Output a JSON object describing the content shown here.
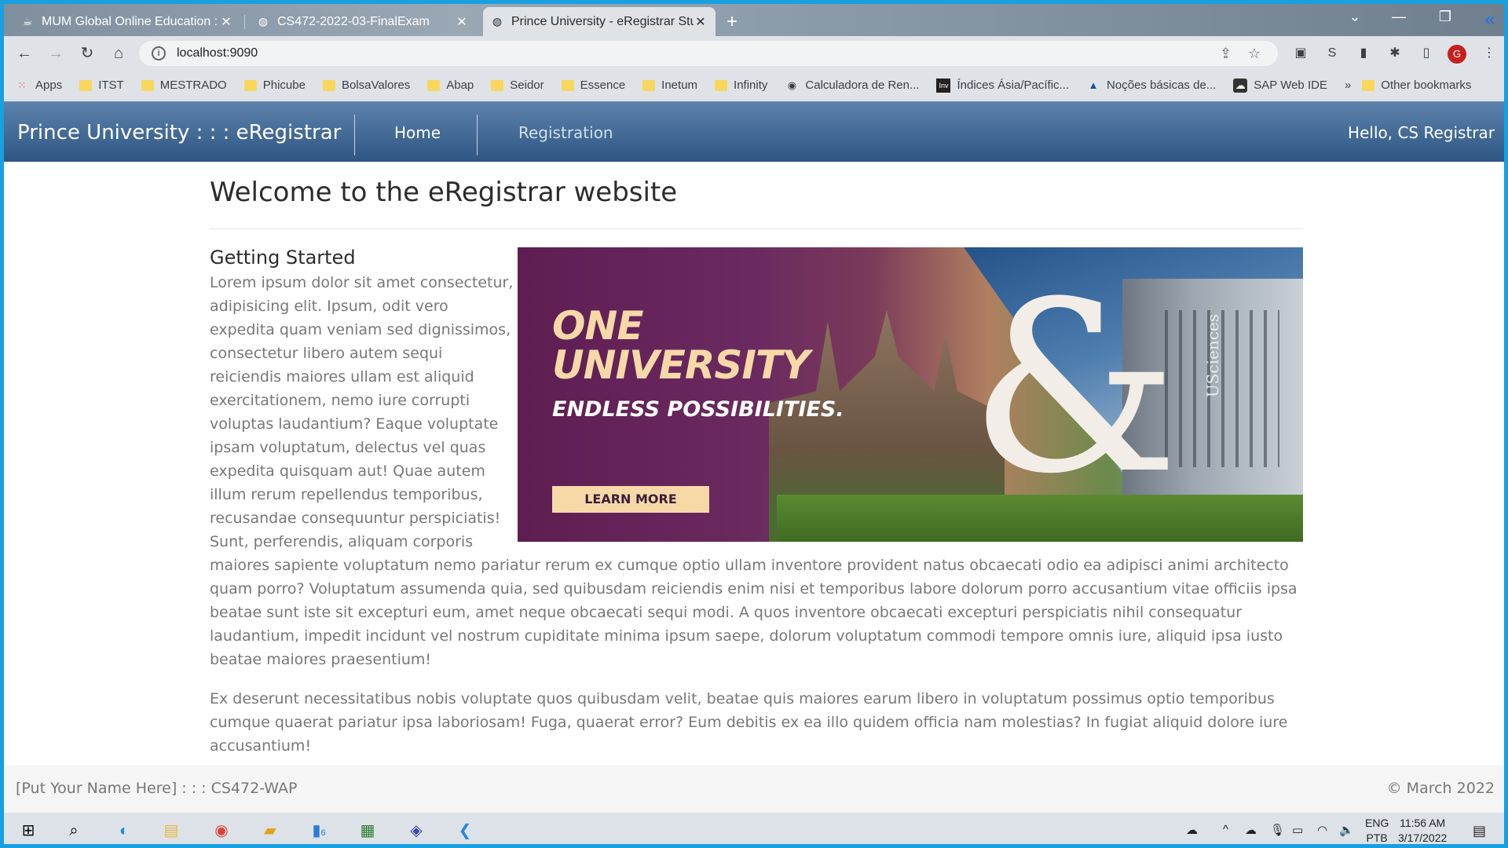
{
  "browser": {
    "tabs": [
      {
        "title": "MUM Global Online Education :",
        "icon": "cup-icon",
        "active": false
      },
      {
        "title": "CS472-2022-03-FinalExam",
        "icon": "globe-icon",
        "active": false
      },
      {
        "title": "Prince University - eRegistrar Stu",
        "icon": "globe-icon",
        "active": true
      }
    ],
    "url": "localhost:9090",
    "profile_initial": "G",
    "bookmarks": [
      {
        "label": "Apps",
        "icon": "apps-grid-icon"
      },
      {
        "label": "ITST",
        "icon": "folder-icon"
      },
      {
        "label": "MESTRADO",
        "icon": "folder-icon"
      },
      {
        "label": "Phicube",
        "icon": "folder-icon"
      },
      {
        "label": "BolsaValores",
        "icon": "folder-icon"
      },
      {
        "label": "Abap",
        "icon": "folder-icon"
      },
      {
        "label": "Seidor",
        "icon": "folder-icon"
      },
      {
        "label": "Essence",
        "icon": "folder-icon"
      },
      {
        "label": "Inetum",
        "icon": "folder-icon"
      },
      {
        "label": "Infinity",
        "icon": "folder-icon"
      },
      {
        "label": "Calculadora de Ren...",
        "icon": "calculator-icon"
      },
      {
        "label": "Índices Ásia/Pacífic...",
        "icon": "investing-icon"
      },
      {
        "label": "Noções básicas de...",
        "icon": "dev-icon"
      },
      {
        "label": "SAP Web IDE",
        "icon": "cloud-icon"
      }
    ],
    "more_bookmarks": "»",
    "other_bookmarks": "Other bookmarks"
  },
  "navbar": {
    "brand": "Prince University : : : eRegistrar",
    "links": [
      "Home",
      "Registration"
    ],
    "greeting": "Hello, CS Registrar"
  },
  "main": {
    "title": "Welcome to the eRegistrar website",
    "subtitle": "Getting Started",
    "banner": {
      "line1": "ONE",
      "line2": "UNIVERSITY",
      "line3": "ENDLESS POSSIBILITIES.",
      "button": "LEARN MORE",
      "brand": "USciences"
    },
    "para1": "Lorem ipsum dolor sit amet consectetur, adipisicing elit. Ipsum, odit vero expedita quam veniam sed dignissimos, consectetur libero autem sequi reiciendis maiores ullam est aliquid exercitationem, nemo iure corrupti voluptas laudantium? Eaque voluptate ipsam voluptatum, delectus vel quas expedita quisquam aut! Quae autem illum rerum repellendus temporibus, recusandae consequuntur perspiciatis! Sunt, perferendis, aliquam corporis maiores sapiente voluptatum nemo pariatur rerum ex cumque optio ullam inventore provident natus obcaecati odio ea adipisci animi architecto quam porro? Voluptatum assumenda quia, sed quibusdam reiciendis enim nisi et temporibus labore dolorum porro accusantium vitae officiis ipsa beatae sunt iste sit excepturi eum, amet neque obcaecati sequi modi. A quos inventore obcaecati excepturi perspiciatis nihil consequatur laudantium, impedit incidunt vel nostrum cupiditate minima ipsum saepe, dolorum voluptatum commodi tempore omnis iure, aliquid ipsa iusto beatae maiores praesentium!",
    "para2": "Ex deserunt necessitatibus nobis voluptate quos quibusdam velit, beatae quis maiores earum libero in voluptatum possimus optio temporibus cumque quaerat pariatur ipsa laboriosam! Fuga, quaerat error? Eum debitis ex ea illo quidem officia nam molestias? In fugiat aliquid dolore iure accusantium!"
  },
  "footer": {
    "left": "[Put Your Name Here] : : : CS472-WAP",
    "right": "© March 2022"
  },
  "taskbar": {
    "badge": "6",
    "lang": [
      "ENG",
      "PTB"
    ],
    "time": "11:56 AM",
    "date": "3/17/2022"
  },
  "colors": {
    "navbar_top": "#5d83ac",
    "navbar_bottom": "#2e5683",
    "screen_border": "#18a0e0",
    "body_text": "#777777"
  }
}
